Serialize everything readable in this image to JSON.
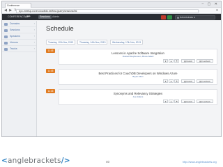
{
  "browser": {
    "tab_label": "Conference",
    "url": "ℹ pc-meetup-novel.cloudfolk.net/fast-jquery/sessions/list"
  },
  "app": {
    "brand_prefix": "CONFERENCE",
    "brand_highlight": "APP",
    "nav": [
      {
        "label": "Sessions",
        "active": true
      },
      {
        "label": "Admin",
        "active": false
      }
    ],
    "user_label": "Administrator ▾"
  },
  "sidebar": {
    "items": [
      {
        "label": "Domains"
      },
      {
        "label": "Sessions"
      },
      {
        "label": "Speakers"
      },
      {
        "label": "Venues"
      },
      {
        "label": "Tracks"
      }
    ]
  },
  "main": {
    "title": "Schedule",
    "day_tabs": [
      {
        "label": "Tuesday, 12th Nov, 2013"
      },
      {
        "label": "Thursday, 14th Nov, 2013"
      },
      {
        "label": "Wednesday, 17th Nov, 2013"
      }
    ],
    "sessions": [
      {
        "time": "11:45",
        "title": "Lessons in Apache Software Integration",
        "speakers": "Russell Stephenson, Bruce Allard"
      },
      {
        "time": "11:45",
        "title": "Best Practices for CouchDB Developers on Windows Azure",
        "speakers": "Bryan Allen"
      },
      {
        "time": "11:45",
        "title": "Synonyms and Relevancy Strategies",
        "speakers": "Joe Adams"
      }
    ],
    "action_labels": {
      "star": "★",
      "thumb": "▲",
      "flag": "⚑",
      "details": "▤ Details",
      "feedback": "▤ Feedback"
    }
  },
  "footer": {
    "logo_open": "<",
    "logo_text": "anglebrackets",
    "logo_close": "/>",
    "page_number": "40",
    "url": "http://www.anglebrackets.org"
  }
}
